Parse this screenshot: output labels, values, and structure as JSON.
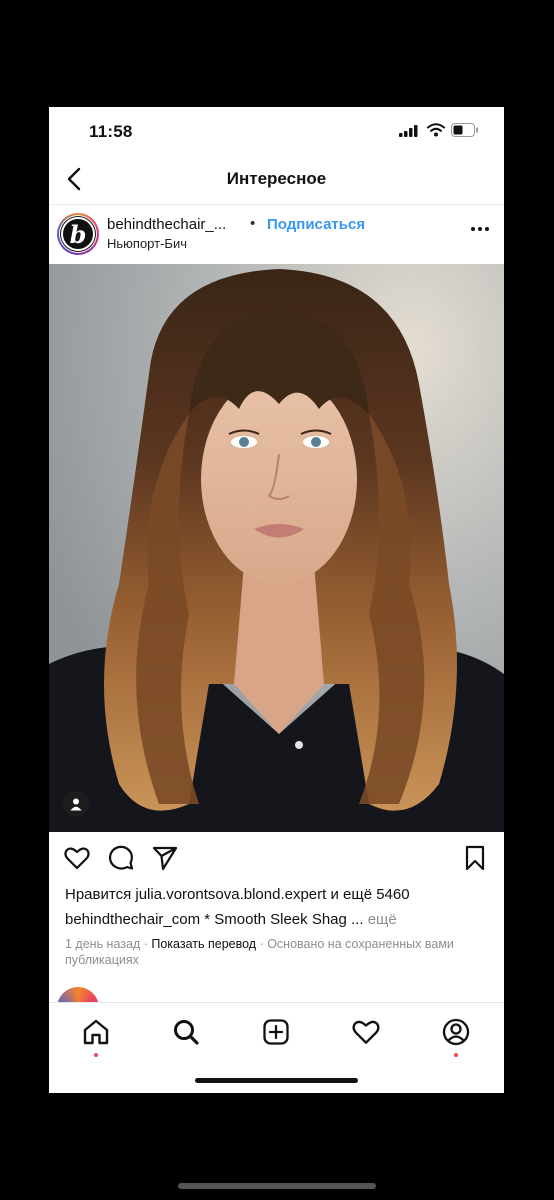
{
  "status_bar": {
    "time": "11:58"
  },
  "header": {
    "title": "Интересное"
  },
  "post": {
    "username": "behindthechair_...",
    "separator": "•",
    "follow_label": "Подписаться",
    "location": "Ньюпорт-Бич",
    "avatar_letter": "b",
    "likes_text": "Нравится julia.vorontsova.blond.expert и ещё 5460",
    "caption_user": "behindthechair_com",
    "caption_text": " * Smooth Sleek Shag ...",
    "caption_more": " ещё",
    "time_ago": "1 день назад",
    "meta_dot1": " · ",
    "translate_label": "Показать перевод",
    "meta_dot2": " · ",
    "reason": "Основано на сохраненных вами публикациях"
  },
  "icons": {
    "back": "chevron-left-icon",
    "more": "more-horizontal-icon",
    "like": "heart-icon",
    "comment": "comment-icon",
    "share": "send-icon",
    "save": "bookmark-icon",
    "tag": "person-icon",
    "tabs": [
      "home-icon",
      "search-icon",
      "plus-square-icon",
      "heart-icon",
      "profile-icon"
    ]
  },
  "colors": {
    "link": "#3897f0",
    "badge": "#ed4956"
  }
}
